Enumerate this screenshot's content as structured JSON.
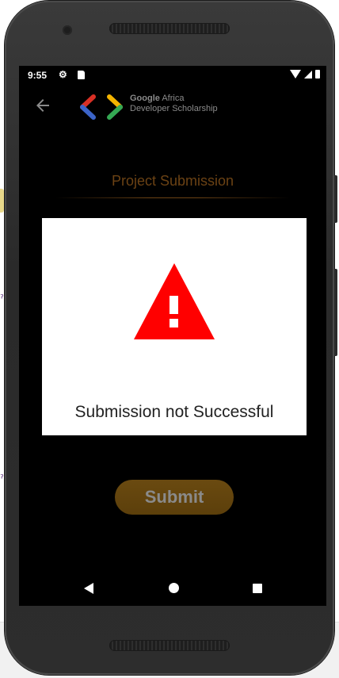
{
  "status_bar": {
    "time": "9:55"
  },
  "app_bar": {
    "brand_line1_bold": "Google",
    "brand_line1_rest": " Africa",
    "brand_line2": "Developer Scholarship"
  },
  "page": {
    "title": "Project Submission",
    "submit_label": "Submit"
  },
  "dialog": {
    "message": "Submission not Successful"
  },
  "colors": {
    "warning_red": "#ff0000",
    "title_brown": "#6b4214",
    "logo_red": "#d93025",
    "logo_blue": "#3c64c8",
    "logo_yellow": "#f4b400",
    "logo_green": "#34a853"
  },
  "icons": [
    "back-arrow-icon",
    "settings-gear-icon",
    "sd-card-icon",
    "wifi-icon",
    "signal-icon",
    "battery-icon",
    "warning-triangle-icon",
    "nav-back-icon",
    "nav-home-icon",
    "nav-recents-icon"
  ]
}
